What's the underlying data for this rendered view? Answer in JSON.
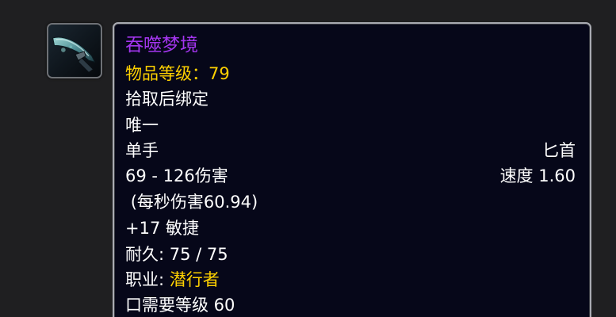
{
  "item": {
    "icon": "dagger-icon",
    "name": "吞噬梦境",
    "item_level_label": "物品等级：",
    "item_level_value": "79",
    "binding": "拾取后绑定",
    "unique": "唯一",
    "slot": "单手",
    "weapon_type": "匕首",
    "damage": "69 - 126伤害",
    "speed": "速度 1.60",
    "dps": "(每秒伤害60.94)",
    "stat": "+17 敏捷",
    "durability": "耐久: 75 / 75",
    "class_label": "职业: ",
    "class_value": "潜行者",
    "requirement": "口需要等级 60"
  },
  "colors": {
    "item_quality_epic": "#a335ee",
    "highlight_gold": "#ffd100",
    "tooltip_background": "#060719",
    "tooltip_border": "#a9abb2"
  }
}
